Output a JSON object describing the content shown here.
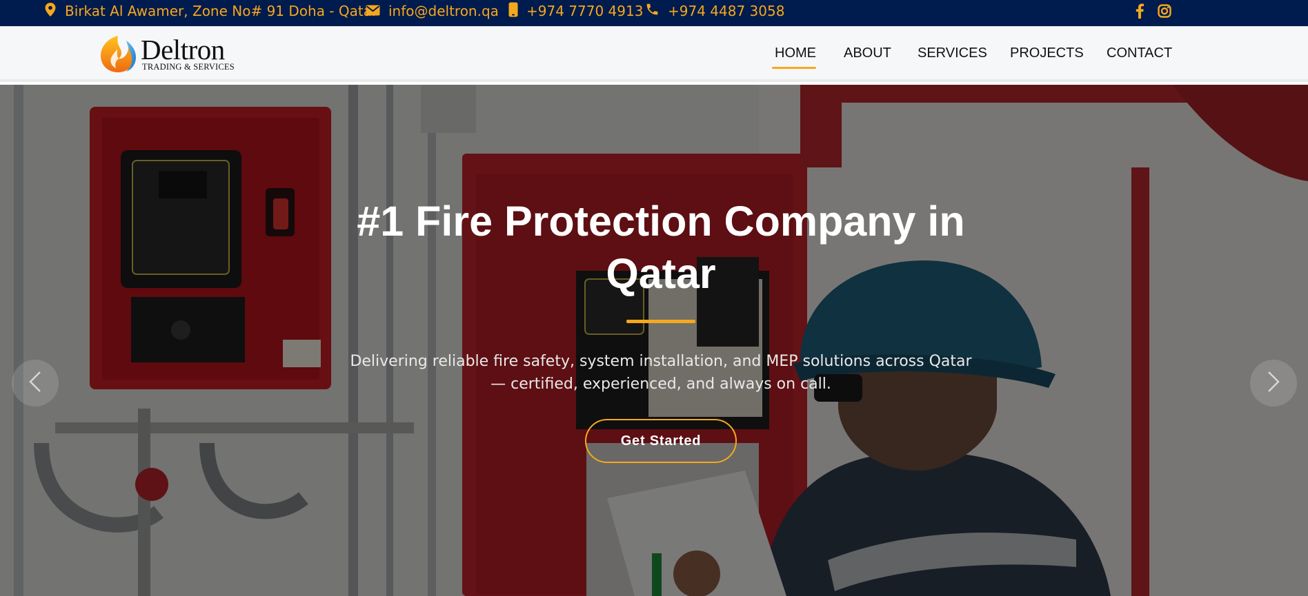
{
  "topbar": {
    "address": "Birkat Al Awamer, Zone No# 91 Doha - Qatar",
    "email": "info@deltron.qa",
    "mobile": "+974 7770 4913",
    "phone": "+974 4487 3058",
    "icons": [
      "map-pin-icon",
      "envelope-icon",
      "mobile-icon",
      "phone-icon",
      "facebook-icon",
      "instagram-icon"
    ]
  },
  "logo": {
    "name": "Deltron",
    "tagline": "TRADING & SERVICES"
  },
  "nav": {
    "items": [
      "HOME",
      "ABOUT",
      "SERVICES",
      "PROJECTS",
      "CONTACT"
    ],
    "active": "HOME"
  },
  "hero": {
    "title": "#1 Fire Protection Company in Qatar",
    "subtitle": "Delivering reliable fire safety, system installation, and MEP solutions across Qatar — certified, experienced, and always on call.",
    "cta_label": "Get Started"
  },
  "colors": {
    "topbar_bg": "#001b4d",
    "accent": "#f6a81d",
    "header_bg": "#f6f7f9",
    "hero_text": "#ffffff"
  }
}
